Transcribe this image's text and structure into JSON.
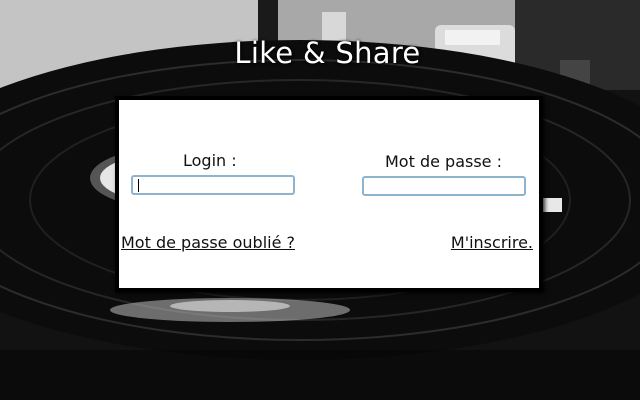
{
  "header": {
    "title": "Like & Share"
  },
  "login_panel": {
    "login_label": "Login :",
    "password_label": "Mot de passe :",
    "login_value": "",
    "password_value": "",
    "forgot_password_link": "Mot de passe oublié ?",
    "register_link": "M'inscrire."
  },
  "colors": {
    "panel_background": "#ffffff",
    "panel_border": "#000000",
    "input_border": "#8eb4cf",
    "title_text": "#ffffff"
  }
}
